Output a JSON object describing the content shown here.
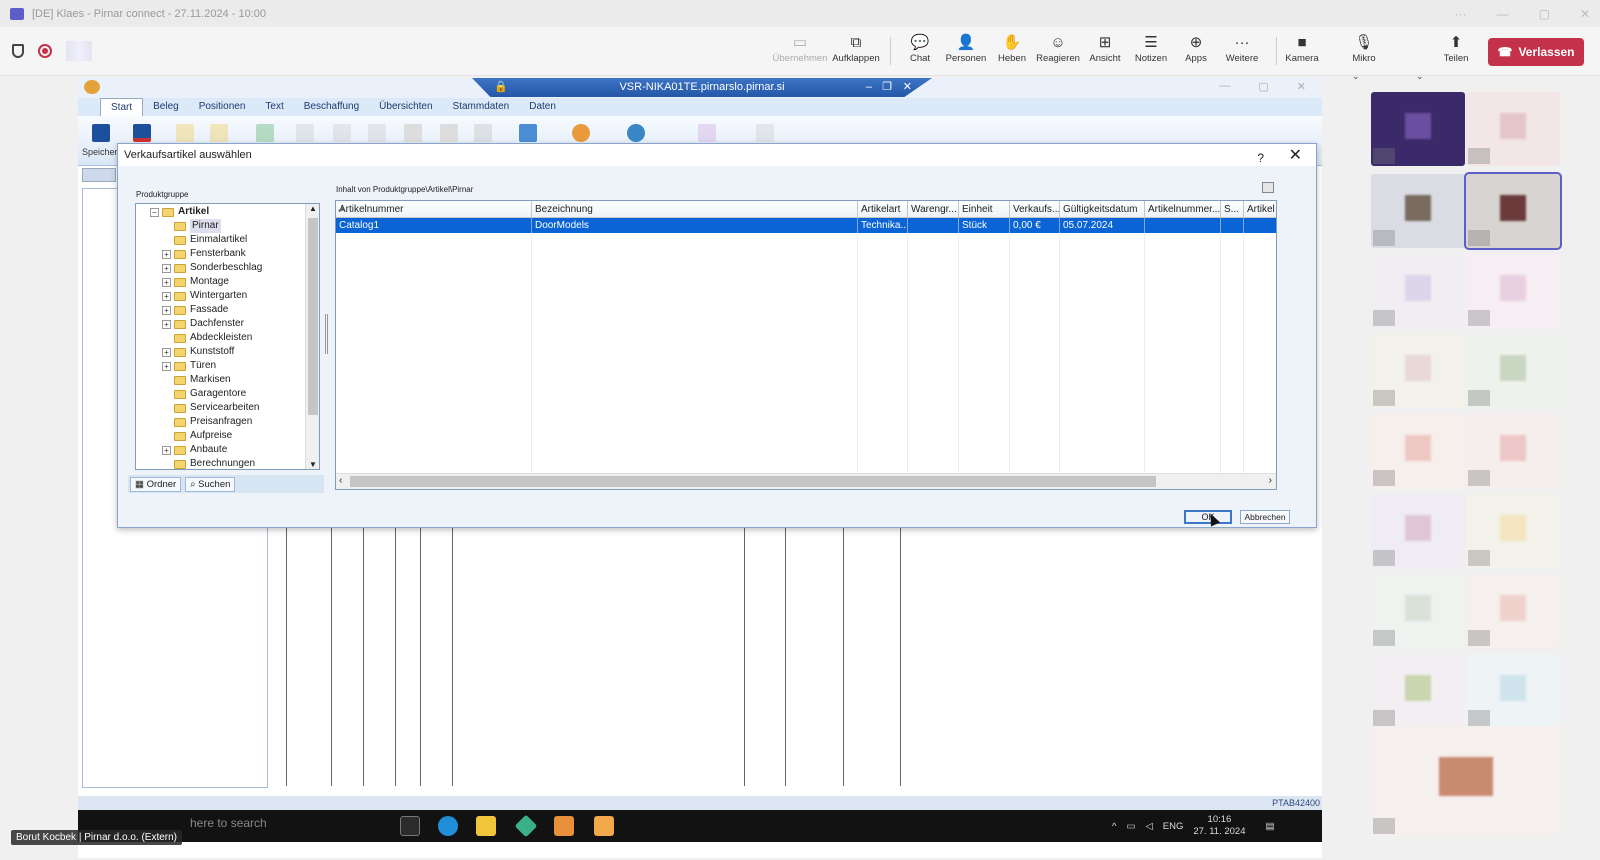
{
  "teams": {
    "title": "[DE] Klaes - Pirnar connect - 27.11.2024 - 10:00",
    "toolbar": {
      "takeover": "Übernehmen",
      "popout": "Aufklappen",
      "chat": "Chat",
      "people": "Personen",
      "raise": "Heben",
      "react": "Reagieren",
      "view": "Ansicht",
      "notes": "Notizen",
      "apps": "Apps",
      "more": "Weitere",
      "camera": "Kamera",
      "mic": "Mikro",
      "share": "Teilen",
      "leave": "Verlassen"
    },
    "caption": "Borut Kocbek | Pirnar d.o.o. (Extern)"
  },
  "app": {
    "title": "VSR-NIKA01TE.pirnarslo.pirnar.si",
    "ribbon_tabs": [
      "Start",
      "Beleg",
      "Positionen",
      "Text",
      "Beschaffung",
      "Übersichten",
      "Stammdaten",
      "Daten"
    ],
    "save_label": "Speicher",
    "status_text": "PTAB42400",
    "taskbar_search": "here to search",
    "tray_lang": "ENG",
    "time": "10:16",
    "date": "27. 11. 2024"
  },
  "dialog": {
    "title": "Verkaufsartikel auswählen",
    "help": "?",
    "close": "✕",
    "product_group_label": "Produktgruppe",
    "contents_label": "Inhalt von Produktgruppe\\Artikel\\Pirnar",
    "tree_root": "Artikel",
    "tree": [
      {
        "label": "Pirnar",
        "expandable": false,
        "selected": true
      },
      {
        "label": "Einmalartikel",
        "expandable": false
      },
      {
        "label": "Fensterbank",
        "expandable": true
      },
      {
        "label": "Sonderbeschlag",
        "expandable": true
      },
      {
        "label": "Montage",
        "expandable": true
      },
      {
        "label": "Wintergarten",
        "expandable": true
      },
      {
        "label": "Fassade",
        "expandable": true
      },
      {
        "label": "Dachfenster",
        "expandable": true
      },
      {
        "label": "Abdeckleisten",
        "expandable": false
      },
      {
        "label": "Kunststoff",
        "expandable": true
      },
      {
        "label": "Türen",
        "expandable": true
      },
      {
        "label": "Markisen",
        "expandable": false
      },
      {
        "label": "Garagentore",
        "expandable": false
      },
      {
        "label": "Servicearbeiten",
        "expandable": false
      },
      {
        "label": "Preisanfragen",
        "expandable": false
      },
      {
        "label": "Aufpreise",
        "expandable": false
      },
      {
        "label": "Anbaute",
        "expandable": true
      },
      {
        "label": "Berechnungen",
        "expandable": false
      }
    ],
    "footer": {
      "folders": "Ordner",
      "search": "Suchen"
    },
    "columns": [
      "Artikelnummer",
      "Bezeichnung",
      "Artikelart",
      "Warengr...",
      "Einheit",
      "Verkaufs...",
      "Gültigkeitsdatum",
      "Artikelnummer...",
      "S...",
      "Artikel"
    ],
    "rows": [
      [
        "Catalog1",
        "DoorModels",
        "Technika...",
        "",
        "Stück",
        "0,00 €",
        "05.07.2024",
        "",
        "",
        ""
      ]
    ],
    "ok": "OK",
    "cancel": "Abbrechen"
  }
}
